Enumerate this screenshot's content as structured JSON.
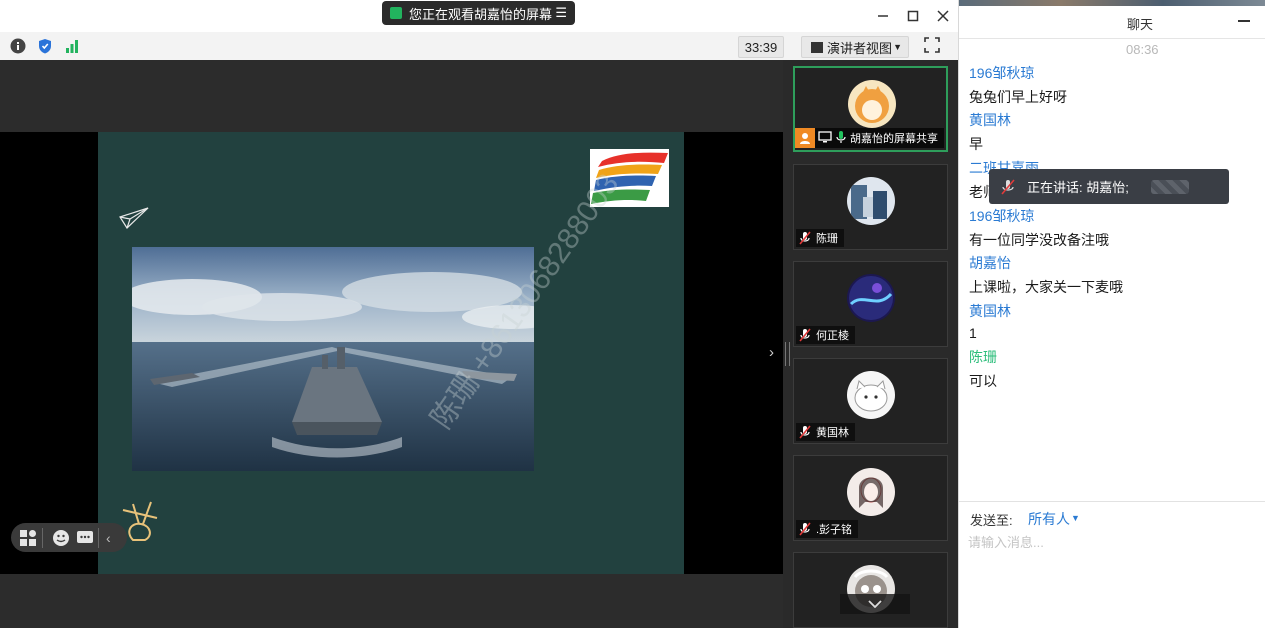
{
  "window": {
    "share_banner": "您正在观看胡嘉怡的屏幕",
    "controls": [
      "minimize",
      "maximize",
      "close"
    ]
  },
  "toolbar": {
    "timer": "33:39",
    "view_mode": "演讲者视图",
    "left_icons": [
      "info-icon",
      "shield-icon",
      "signal-icon"
    ]
  },
  "shared_slide": {
    "watermark": "陈珊 +8613068288003",
    "background_color": "#22413f"
  },
  "participants": [
    {
      "name": "胡嘉怡的屏幕共享",
      "active": true,
      "avatar_color": "#f0c070"
    },
    {
      "name": "陈珊",
      "active": false,
      "avatar_color": "#4a6a8a"
    },
    {
      "name": "何正棱",
      "active": false,
      "avatar_color": "#3a2f8a"
    },
    {
      "name": "黄国林",
      "active": false,
      "avatar_color": "#f4f4f4"
    },
    {
      "name": ".彭子铭",
      "active": false,
      "avatar_color": "#f3ece9"
    }
  ],
  "chat": {
    "title": "聊天",
    "time": "08:36",
    "messages": [
      {
        "name": "196邹秋琼",
        "text": "兔兔们早上好呀",
        "name_color": "blue"
      },
      {
        "name": "黄国林",
        "text": "早",
        "name_color": "blue"
      },
      {
        "name": "二班甘嘉雨",
        "text": "老师",
        "name_color": "blue"
      },
      {
        "name": "196邹秋琼",
        "text": "有一位同学没改备注哦",
        "name_color": "blue"
      },
      {
        "name": "胡嘉怡",
        "text": "上课啦，大家关一下麦哦",
        "name_color": "blue"
      },
      {
        "name": "黄国林",
        "text": "1",
        "name_color": "blue"
      },
      {
        "name": "陈珊",
        "text": "可以",
        "name_color": "green"
      }
    ],
    "speaking_toast": "正在讲话: 胡嘉怡;",
    "send_to_label": "发送至:",
    "send_to_target": "所有人",
    "input_placeholder": "请输入消息..."
  }
}
